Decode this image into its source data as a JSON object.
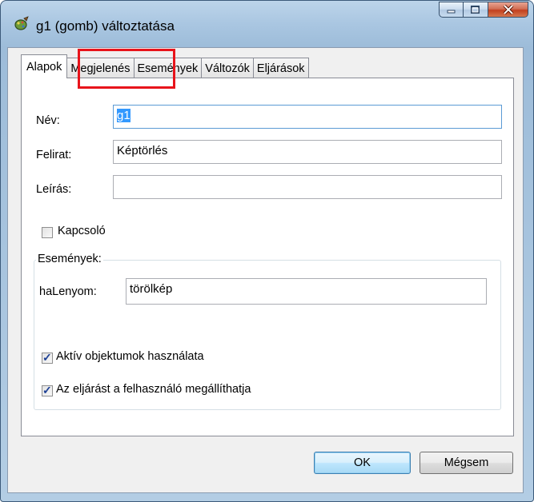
{
  "window": {
    "title": "g1 (gomb) változtatása"
  },
  "tabs": [
    {
      "label": "Alapok",
      "active": true
    },
    {
      "label": "Megjelenés",
      "active": false
    },
    {
      "label": "Események",
      "active": false
    },
    {
      "label": "Változók",
      "active": false
    },
    {
      "label": "Eljárások",
      "active": false
    }
  ],
  "form": {
    "nev": {
      "label": "Név:",
      "value": "g1"
    },
    "felirat": {
      "label": "Felirat:",
      "value": "Képtörlés"
    },
    "leiras": {
      "label": "Leírás:",
      "value": ""
    },
    "kapcsolo": {
      "label": "Kapcsoló",
      "checked": false
    }
  },
  "events_group": {
    "legend": "Események:",
    "halenyom": {
      "label": "haLenyom:",
      "value": "törölkép"
    },
    "aktiv": {
      "label": "Aktív objektumok használata",
      "checked": true
    },
    "megallithatja": {
      "label": "Az eljárást a felhasználó megállíthatja",
      "checked": true
    }
  },
  "buttons": {
    "ok": "OK",
    "cancel": "Mégsem"
  },
  "icons": [
    "app-icon",
    "minimize-icon",
    "maximize-icon",
    "close-icon",
    "checkmark-icon"
  ],
  "colors": {
    "highlight": "#e8141b",
    "selection": "#3399ff"
  }
}
